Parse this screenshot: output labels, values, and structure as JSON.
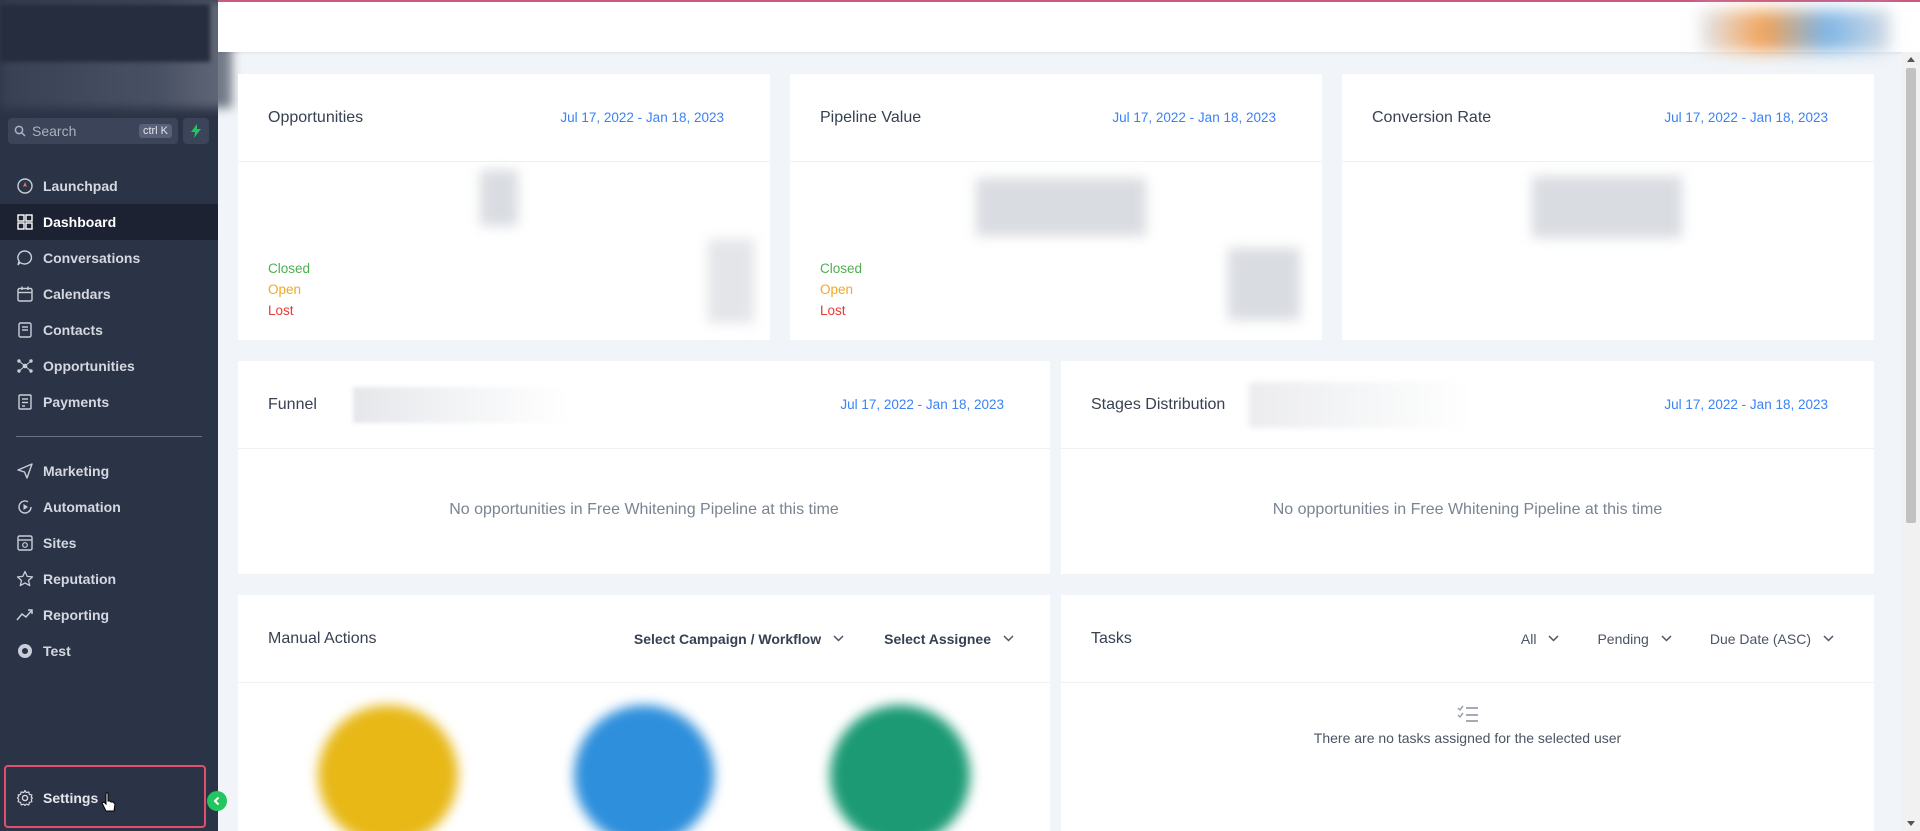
{
  "sidebar": {
    "search": {
      "label": "Search",
      "shortcut": "ctrl K"
    },
    "items": [
      {
        "label": "Launchpad",
        "icon": "launchpad-icon"
      },
      {
        "label": "Dashboard",
        "icon": "dashboard-icon",
        "active": true
      },
      {
        "label": "Conversations",
        "icon": "chat-icon"
      },
      {
        "label": "Calendars",
        "icon": "calendar-icon"
      },
      {
        "label": "Contacts",
        "icon": "contacts-icon"
      },
      {
        "label": "Opportunities",
        "icon": "opportunities-icon"
      },
      {
        "label": "Payments",
        "icon": "payments-icon"
      }
    ],
    "items2": [
      {
        "label": "Marketing",
        "icon": "send-icon"
      },
      {
        "label": "Automation",
        "icon": "automation-icon"
      },
      {
        "label": "Sites",
        "icon": "sites-icon"
      },
      {
        "label": "Reputation",
        "icon": "star-icon"
      },
      {
        "label": "Reporting",
        "icon": "trend-icon"
      },
      {
        "label": "Test",
        "icon": "test-icon"
      }
    ],
    "settings": {
      "label": "Settings",
      "icon": "gear-icon"
    }
  },
  "cards": {
    "opportunities": {
      "title": "Opportunities",
      "date": "Jul 17, 2022 - Jan 18, 2023",
      "legend": [
        "Closed",
        "Open",
        "Lost"
      ]
    },
    "pipeline": {
      "title": "Pipeline Value",
      "date": "Jul 17, 2022 - Jan 18, 2023",
      "legend": [
        "Closed",
        "Open",
        "Lost"
      ]
    },
    "conversion": {
      "title": "Conversion Rate",
      "date": "Jul 17, 2022 - Jan 18, 2023"
    },
    "funnel": {
      "title": "Funnel",
      "date": "Jul 17, 2022 - Jan 18, 2023",
      "empty": "No opportunities in Free Whitening Pipeline at this time"
    },
    "stages": {
      "title": "Stages Distribution",
      "date": "Jul 17, 2022 - Jan 18, 2023",
      "empty": "No opportunities in Free Whitening Pipeline at this time"
    },
    "manual": {
      "title": "Manual Actions",
      "campaign": "Select Campaign / Workflow",
      "assignee": "Select Assignee"
    },
    "tasks": {
      "title": "Tasks",
      "filter_all": "All",
      "filter_status": "Pending",
      "sort": "Due Date (ASC)",
      "empty": "There are no tasks assigned for the selected user"
    }
  },
  "colors": {
    "sidebar_bg": "#2b3346",
    "accent_blue": "#3b82f6",
    "closed": "#4caf50",
    "open": "#f5a623",
    "lost": "#e53935",
    "circle_yellow": "#e8b817",
    "circle_blue": "#2e8fdc",
    "circle_green": "#1b9a74"
  }
}
